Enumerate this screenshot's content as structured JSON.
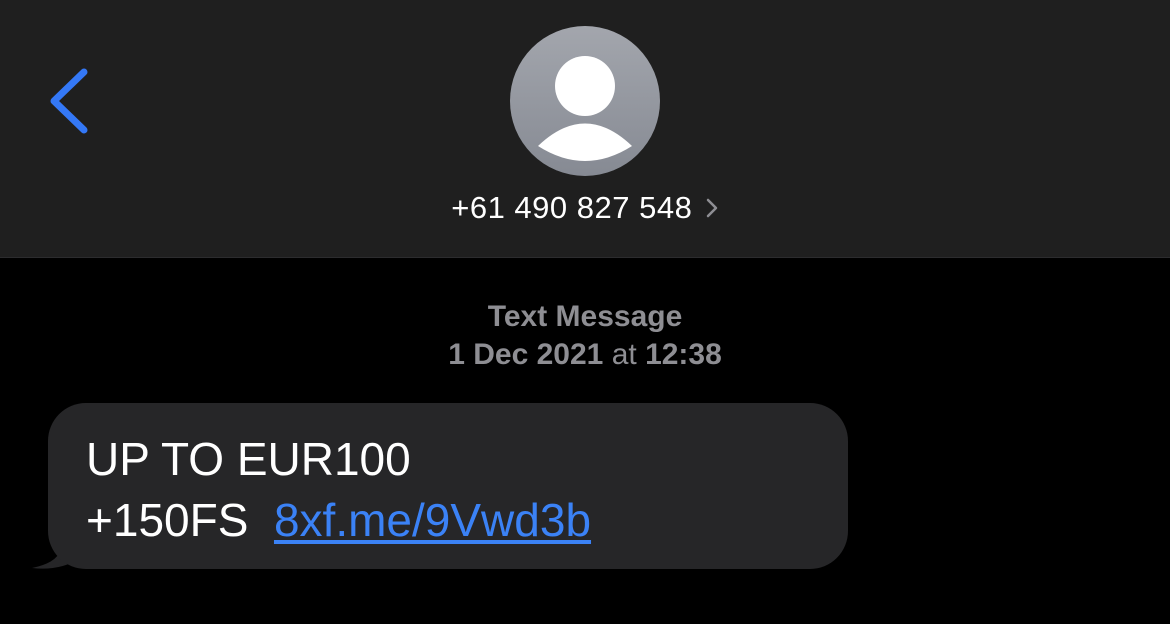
{
  "header": {
    "back_icon": "chevron-left-icon",
    "avatar_icon": "person-icon",
    "contact_number": "+61 490 827 548",
    "contact_chevron_icon": "chevron-right-icon"
  },
  "thread": {
    "service": "Text Message",
    "date": "1 Dec 2021",
    "at": "at",
    "time": "12:38"
  },
  "message": {
    "text": "UP TO EUR100 +150FS",
    "link": "8xf.me/9Vwd3b"
  },
  "colors": {
    "accent": "#3478f6",
    "header_bg": "#1f1f1f",
    "bubble_bg": "#262628",
    "meta_text": "#8e8e93"
  }
}
